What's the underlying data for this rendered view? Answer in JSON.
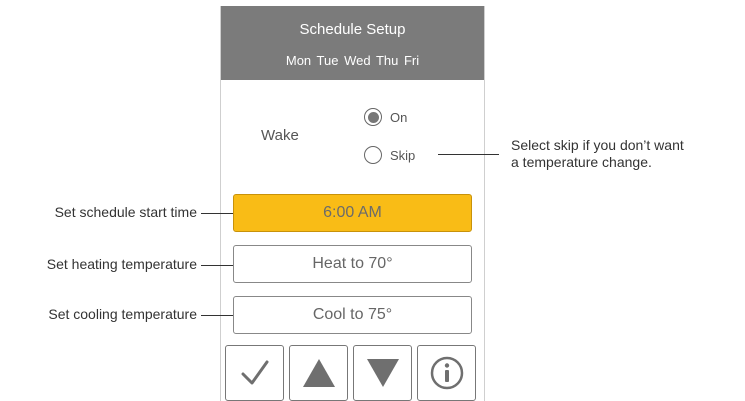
{
  "schedule": {
    "title": "Schedule Setup",
    "days": "Mon Tue Wed Thu Fri",
    "period_label": "Wake",
    "options": [
      {
        "label": "On",
        "selected": true
      },
      {
        "label": "Skip",
        "selected": false
      }
    ],
    "start_time": "6:00 AM",
    "heat": "Heat to 70°",
    "cool": "Cool to 75°"
  },
  "buttons": [
    {
      "name": "confirm",
      "icon": "checkmark-icon"
    },
    {
      "name": "up",
      "icon": "triangle-up-icon"
    },
    {
      "name": "down",
      "icon": "triangle-down-icon"
    },
    {
      "name": "info",
      "icon": "info-icon"
    }
  ],
  "annotations": {
    "start_time": "Set schedule start time",
    "heating": "Set heating temperature",
    "cooling": "Set cooling temperature",
    "skip_line1": "Select skip if you don’t want",
    "skip_line2": "a temperature change."
  },
  "colors": {
    "header": "#7b7b7b",
    "active_field": "#f9bc16",
    "icon": "#6f6f6f"
  }
}
